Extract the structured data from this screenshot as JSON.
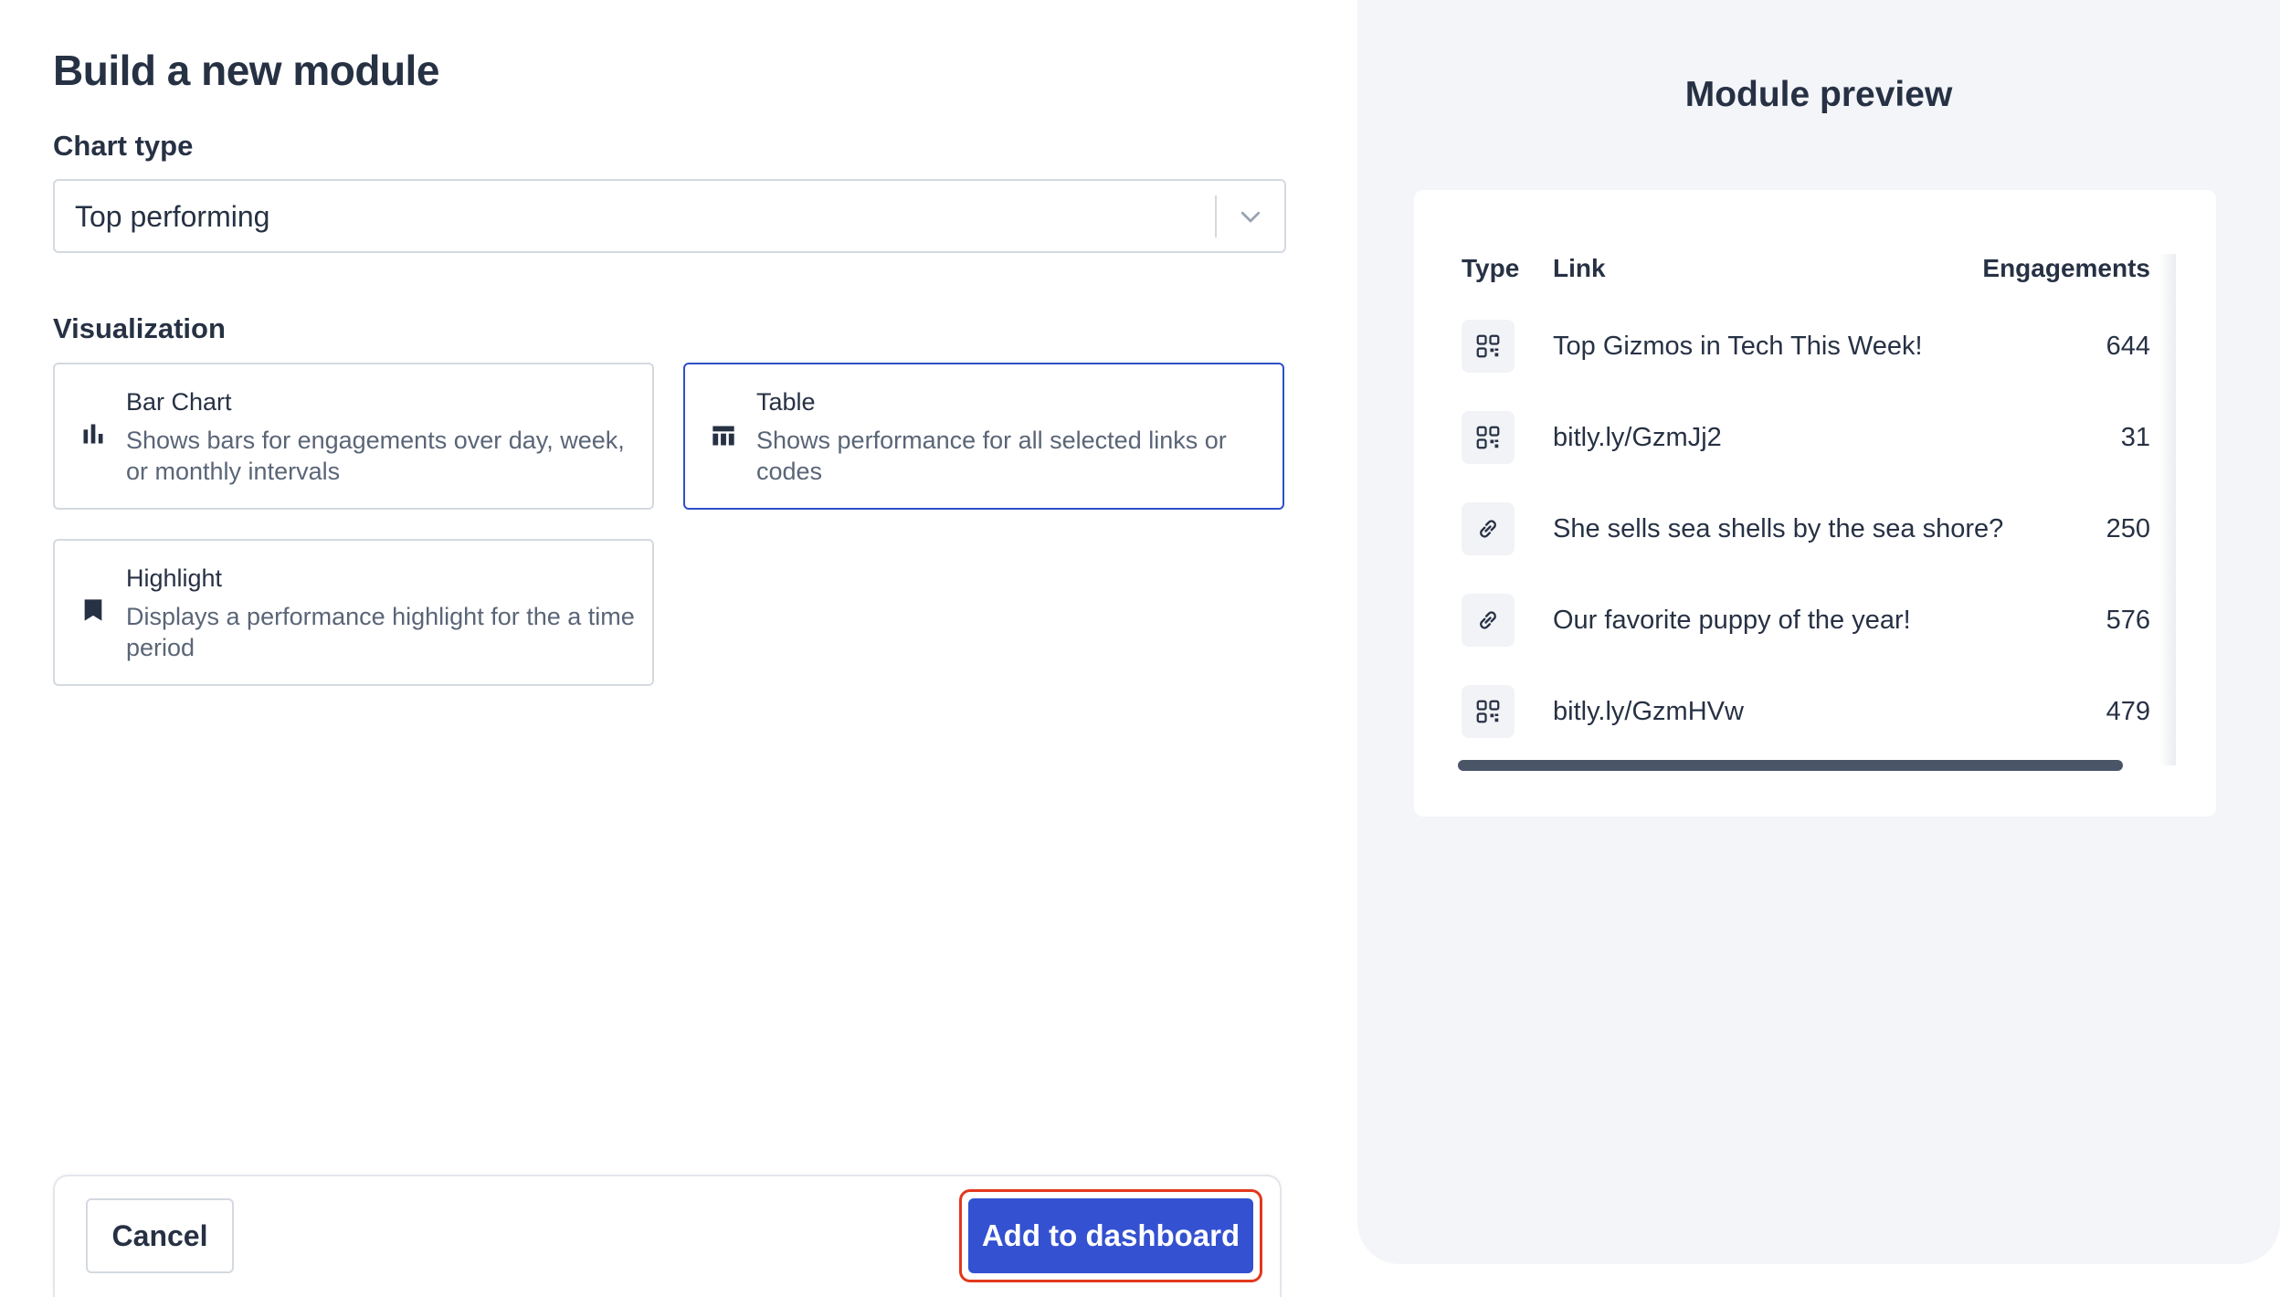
{
  "form": {
    "title": "Build a new module",
    "chart_type_label": "Chart type",
    "chart_type_value": "Top performing",
    "visualization_label": "Visualization",
    "options": [
      {
        "title": "Bar Chart",
        "description": "Shows bars for engagements over day, week, or monthly intervals",
        "icon": "bar-chart-icon",
        "selected": false
      },
      {
        "title": "Table",
        "description": "Shows performance for all selected links or codes",
        "icon": "table-icon",
        "selected": true
      },
      {
        "title": "Highlight",
        "description": "Displays a performance highlight for the a time period",
        "icon": "bookmark-icon",
        "selected": false
      }
    ]
  },
  "footer": {
    "cancel_label": "Cancel",
    "add_label": "Add to dashboard"
  },
  "preview": {
    "title": "Module preview",
    "columns": [
      "Type",
      "Link",
      "Engagements"
    ],
    "rows": [
      {
        "type_icon": "qr-code-icon",
        "link": "Top Gizmos in Tech This Week!",
        "engagements": "644"
      },
      {
        "type_icon": "qr-code-icon",
        "link": "bitly.ly/GzmJj2",
        "engagements": "31"
      },
      {
        "type_icon": "link-icon",
        "link": "She sells sea shells by the sea shore?",
        "engagements": "250"
      },
      {
        "type_icon": "link-icon",
        "link": "Our favorite puppy of the year!",
        "engagements": "576"
      },
      {
        "type_icon": "qr-code-icon",
        "link": "bitly.ly/GzmHVw",
        "engagements": "479"
      }
    ]
  },
  "colors": {
    "accent": "#3451d1",
    "selected_border": "#2f4fc8",
    "highlight_ring": "#e2381e",
    "preview_bg": "#f3f5f9",
    "text": "#273144"
  }
}
